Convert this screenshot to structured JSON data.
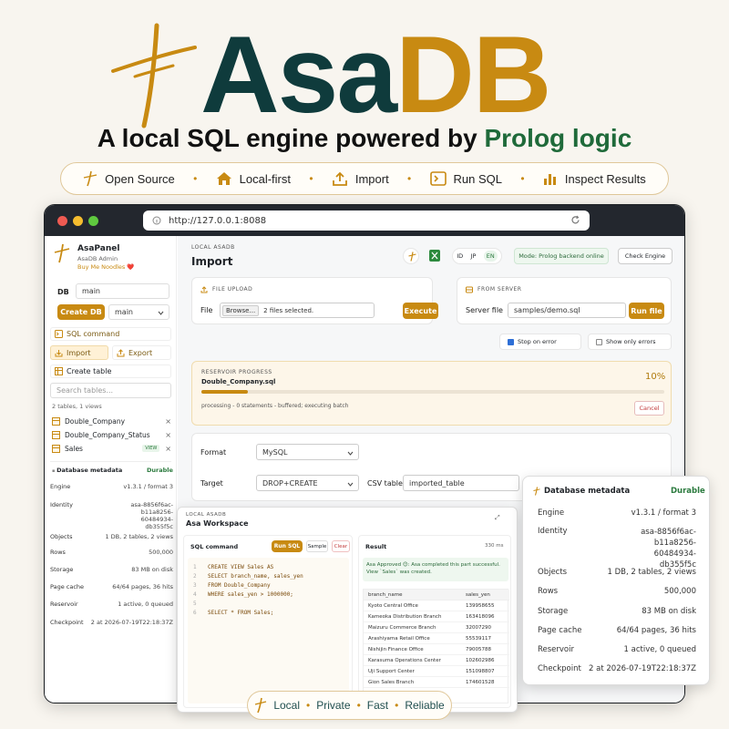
{
  "hero": {
    "title_a": "Asa",
    "title_b": "DB",
    "tagline_a": "A local SQL engine powered by ",
    "tagline_b": "Prolog logic"
  },
  "features": [
    "Open Source",
    "Local-first",
    "Import",
    "Run SQL",
    "Inspect Results"
  ],
  "browser": {
    "url": "http://127.0.0.1:8088"
  },
  "sidebar": {
    "app_name": "AsaPanel",
    "app_sub": "AsaDB Admin",
    "donate": "Buy Me Noodles ❤️",
    "db_label": "DB",
    "db_value": "main",
    "create_btn": "Create DB",
    "db_select": "main",
    "sql_command": "SQL command",
    "import": "Import",
    "export": "Export",
    "create_table": "Create table",
    "search_placeholder": "Search tables...",
    "summary": "2 tables, 1 views",
    "tables": [
      {
        "name": "Double_Company"
      },
      {
        "name": "Double_Company_Status"
      },
      {
        "name": "Sales",
        "badge": "VIEW"
      }
    ],
    "meta_title": "Database metadata",
    "meta_badge": "Durable",
    "meta": [
      {
        "k": "Engine",
        "v": "v1.3.1 / format 3"
      },
      {
        "k": "Identity",
        "v": "asa-8856f6ac-b11a8256-60484934-db355f5c"
      },
      {
        "k": "Objects",
        "v": "1 DB, 2 tables, 2 views"
      },
      {
        "k": "Rows",
        "v": "500,000"
      },
      {
        "k": "Storage",
        "v": "83 MB on disk"
      },
      {
        "k": "Page cache",
        "v": "64/64 pages, 36 hits"
      },
      {
        "k": "Reservoir",
        "v": "1 active, 0 queued"
      },
      {
        "k": "Checkpoint",
        "v": "2 at 2026-07-19T22:18:37Z"
      }
    ]
  },
  "main": {
    "crumb": "LOCAL ASADB",
    "title": "Import",
    "langs": [
      "ID",
      "JP",
      "EN"
    ],
    "mode": "Mode: Prolog backend online",
    "check_btn": "Check Engine",
    "file_upload": {
      "head": "FILE UPLOAD",
      "label": "File",
      "browse": "Browse...",
      "files": "2 files selected.",
      "exec": "Execute"
    },
    "from_server": {
      "head": "FROM SERVER",
      "label": "Server file",
      "value": "samples/demo.sql",
      "run": "Run file"
    },
    "stop_on_error": "Stop on error",
    "only_errors": "Show only errors",
    "progress": {
      "head": "RESERVOIR PROGRESS",
      "file": "Double_Company.sql",
      "percent": "10%",
      "value": 0.1,
      "status": "processing - 0 statements - buffered; executing batch",
      "cancel": "Cancel"
    },
    "format_label": "Format",
    "format_value": "MySQL",
    "target_label": "Target",
    "target_value": "DROP+CREATE",
    "csv_label": "CSV table",
    "csv_value": "imported_table"
  },
  "workspace": {
    "crumb": "LOCAL ASADB",
    "title": "Asa Workspace",
    "sql_label": "SQL command",
    "run": "Run SQL",
    "sample": "Sample",
    "clear": "Clear",
    "result_label": "Result",
    "ms": "330 ms",
    "code": [
      {
        "n": "1",
        "t": "CREATE VIEW Sales AS"
      },
      {
        "n": "2",
        "t": "SELECT branch_name, sales_yen"
      },
      {
        "n": "3",
        "t": "FROM Double_Company"
      },
      {
        "n": "4",
        "t": "WHERE sales_yen > 1000000;"
      },
      {
        "n": "5",
        "t": ""
      },
      {
        "n": "6",
        "t": "SELECT * FROM Sales;"
      }
    ],
    "approved": "Asa Approved 😊: Asa completed this part successful. View `Sales` was created.",
    "cols": [
      "branch_name",
      "sales_yen"
    ],
    "rows": [
      [
        "Kyoto Central Office",
        "139958655"
      ],
      [
        "Kameoka Distribution Branch",
        "163418096"
      ],
      [
        "Maizuru Commerce Branch",
        "32007290"
      ],
      [
        "Arashiyama Retail Office",
        "55539117"
      ],
      [
        "Nishijin Finance Office",
        "79005788"
      ],
      [
        "Karasuma Operations Center",
        "102602986"
      ],
      [
        "Uji Support Center",
        "151098807"
      ],
      [
        "Gion Sales Branch",
        "174601528"
      ]
    ]
  },
  "meta_card": {
    "title": "Database metadata",
    "badge": "Durable",
    "rows": [
      {
        "k": "Engine",
        "v": "v1.3.1 / format 3"
      },
      {
        "k": "Identity",
        "v": "asa-8856f6ac-b11a8256-60484934-db355f5c"
      },
      {
        "k": "Objects",
        "v": "1 DB, 2 tables, 2 views"
      },
      {
        "k": "Rows",
        "v": "500,000"
      },
      {
        "k": "Storage",
        "v": "83 MB on disk"
      },
      {
        "k": "Page cache",
        "v": "64/64 pages, 36 hits"
      },
      {
        "k": "Reservoir",
        "v": "1 active, 0 queued"
      },
      {
        "k": "Checkpoint",
        "v": "2 at 2026-07-19T22:18:37Z"
      }
    ]
  },
  "bottom": [
    "Local",
    "Private",
    "Fast",
    "Reliable"
  ],
  "colors": {
    "gold": "#c88a12",
    "teal": "#0f3b3c",
    "green": "#1f6a3a"
  }
}
